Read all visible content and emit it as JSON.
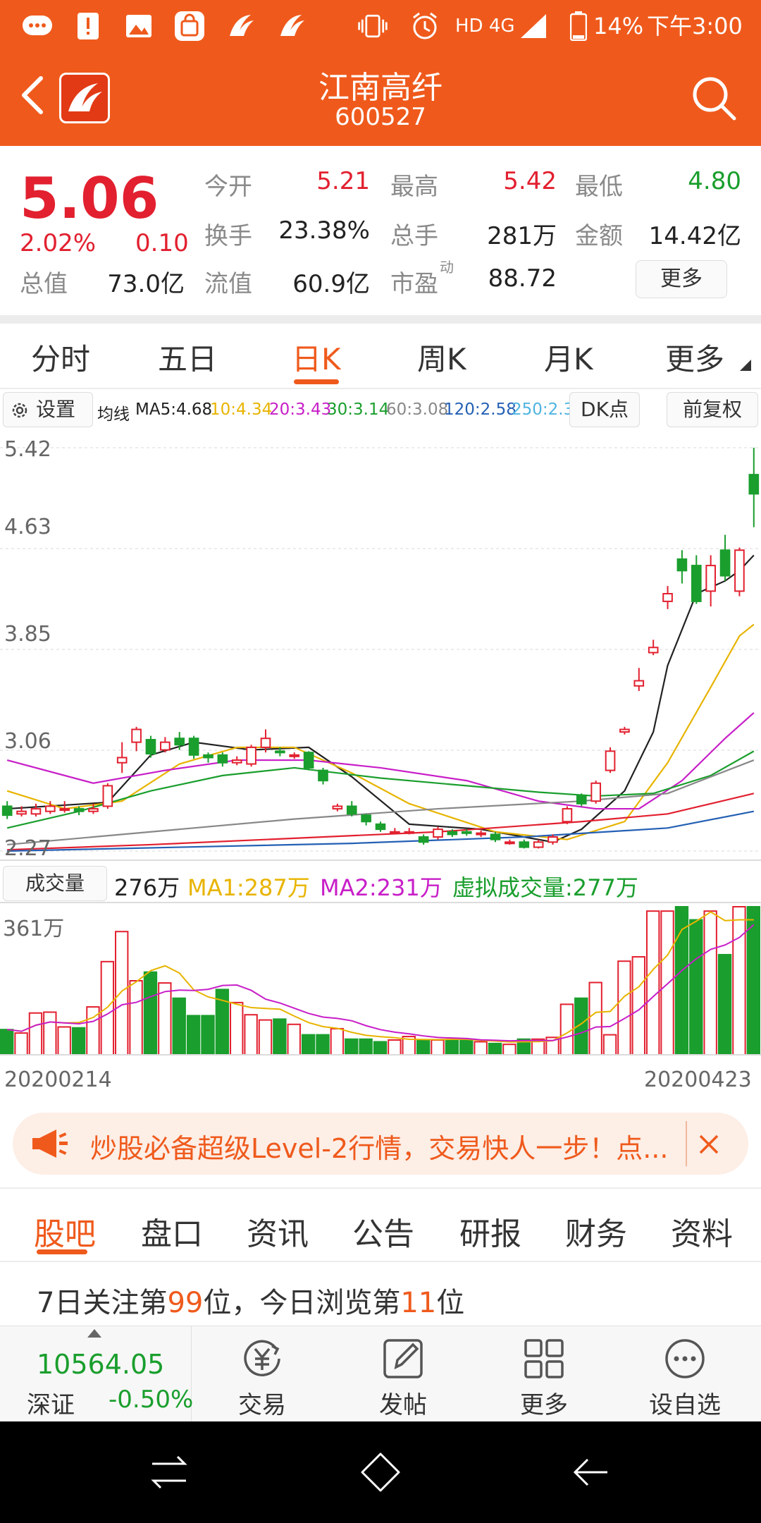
{
  "status_bar": {
    "network": "HD 4G",
    "battery": "14%",
    "time": "下午3:00"
  },
  "header": {
    "stock_name": "江南高纤",
    "stock_code": "600527"
  },
  "quote": {
    "price": "5.06",
    "change_pct": "2.02%",
    "change": "0.10",
    "fields": [
      {
        "label": "今开",
        "value": "5.21",
        "color": "#e2202f"
      },
      {
        "label": "最高",
        "value": "5.42",
        "color": "#e2202f"
      },
      {
        "label": "最低",
        "value": "4.80",
        "color": "#1a9e2d"
      },
      {
        "label": "换手",
        "value": "23.38%",
        "color": "#222222"
      },
      {
        "label": "总手",
        "value": "281万",
        "color": "#222222"
      },
      {
        "label": "金额",
        "value": "14.42亿",
        "color": "#222222"
      },
      {
        "label": "总值",
        "value": "73.0亿",
        "color": "#222222"
      },
      {
        "label": "流值",
        "value": "60.9亿",
        "color": "#222222"
      },
      {
        "label": "市盈",
        "value": "88.72",
        "color": "#222222"
      }
    ],
    "pe_superscript": "动",
    "more_label": "更多"
  },
  "period_tabs": [
    "分时",
    "五日",
    "日K",
    "周K",
    "月K",
    "更多"
  ],
  "period_active": "日K",
  "indicator_bar": {
    "settings_label": "设置",
    "ma_prefix": "均线",
    "ma": [
      {
        "text": "MA5:4.68",
        "color": "#222222"
      },
      {
        "text": "10:4.34",
        "color": "#e8b400"
      },
      {
        "text": "20:3.43",
        "color": "#c81ec8"
      },
      {
        "text": "30:3.14",
        "color": "#1a9e2d"
      },
      {
        "text": "60:3.08",
        "color": "#888888"
      },
      {
        "text": "120:2.58",
        "color": "#2460b4"
      },
      {
        "text": "250:2.3",
        "color": "#4fb4e0"
      }
    ],
    "dk_label": "DK点",
    "adjust_label": "前复权"
  },
  "price_axis": [
    "5.42",
    "4.63",
    "3.85",
    "3.06",
    "2.27"
  ],
  "chart_data": {
    "type": "candlestick",
    "ylim": [
      2.27,
      5.42
    ],
    "date_start": "20200214",
    "date_end": "20200423",
    "candles": [
      {
        "o": 2.62,
        "c": 2.55,
        "h": 2.66,
        "l": 2.52
      },
      {
        "o": 2.56,
        "c": 2.58,
        "h": 2.62,
        "l": 2.54
      },
      {
        "o": 2.56,
        "c": 2.6,
        "h": 2.64,
        "l": 2.54
      },
      {
        "o": 2.58,
        "c": 2.62,
        "h": 2.66,
        "l": 2.56
      },
      {
        "o": 2.6,
        "c": 2.6,
        "h": 2.66,
        "l": 2.57
      },
      {
        "o": 2.6,
        "c": 2.58,
        "h": 2.62,
        "l": 2.55
      },
      {
        "o": 2.58,
        "c": 2.6,
        "h": 2.64,
        "l": 2.56
      },
      {
        "o": 2.62,
        "c": 2.78,
        "h": 2.8,
        "l": 2.6
      },
      {
        "o": 2.96,
        "c": 3.0,
        "h": 3.12,
        "l": 2.88
      },
      {
        "o": 3.12,
        "c": 3.22,
        "h": 3.24,
        "l": 3.05
      },
      {
        "o": 3.14,
        "c": 3.03,
        "h": 3.17,
        "l": 3.0
      },
      {
        "o": 3.06,
        "c": 3.12,
        "h": 3.16,
        "l": 3.04
      },
      {
        "o": 3.15,
        "c": 3.1,
        "h": 3.2,
        "l": 3.06
      },
      {
        "o": 3.15,
        "c": 3.02,
        "h": 3.17,
        "l": 2.99
      },
      {
        "o": 3.02,
        "c": 3.0,
        "h": 3.04,
        "l": 2.96
      },
      {
        "o": 3.02,
        "c": 2.96,
        "h": 3.04,
        "l": 2.93
      },
      {
        "o": 2.96,
        "c": 2.98,
        "h": 3.01,
        "l": 2.94
      },
      {
        "o": 2.95,
        "c": 3.08,
        "h": 3.1,
        "l": 2.93
      },
      {
        "o": 3.08,
        "c": 3.15,
        "h": 3.22,
        "l": 3.04
      },
      {
        "o": 3.05,
        "c": 3.04,
        "h": 3.08,
        "l": 3.01
      },
      {
        "o": 3.02,
        "c": 3.02,
        "h": 3.04,
        "l": 2.99
      },
      {
        "o": 3.04,
        "c": 2.92,
        "h": 3.05,
        "l": 2.9
      },
      {
        "o": 2.9,
        "c": 2.82,
        "h": 2.92,
        "l": 2.79
      },
      {
        "o": 2.6,
        "c": 2.62,
        "h": 2.64,
        "l": 2.58
      },
      {
        "o": 2.62,
        "c": 2.56,
        "h": 2.66,
        "l": 2.54
      },
      {
        "o": 2.55,
        "c": 2.5,
        "h": 2.56,
        "l": 2.47
      },
      {
        "o": 2.48,
        "c": 2.44,
        "h": 2.5,
        "l": 2.42
      },
      {
        "o": 2.42,
        "c": 2.42,
        "h": 2.45,
        "l": 2.4
      },
      {
        "o": 2.42,
        "c": 2.42,
        "h": 2.45,
        "l": 2.4
      },
      {
        "o": 2.38,
        "c": 2.34,
        "h": 2.4,
        "l": 2.32
      },
      {
        "o": 2.38,
        "c": 2.44,
        "h": 2.46,
        "l": 2.36
      },
      {
        "o": 2.42,
        "c": 2.4,
        "h": 2.44,
        "l": 2.38
      },
      {
        "o": 2.42,
        "c": 2.41,
        "h": 2.44,
        "l": 2.39
      },
      {
        "o": 2.4,
        "c": 2.41,
        "h": 2.43,
        "l": 2.38
      },
      {
        "o": 2.4,
        "c": 2.36,
        "h": 2.42,
        "l": 2.34
      },
      {
        "o": 2.34,
        "c": 2.34,
        "h": 2.36,
        "l": 2.32
      },
      {
        "o": 2.34,
        "c": 2.3,
        "h": 2.36,
        "l": 2.29
      },
      {
        "o": 2.3,
        "c": 2.34,
        "h": 2.36,
        "l": 2.29
      },
      {
        "o": 2.34,
        "c": 2.38,
        "h": 2.4,
        "l": 2.32
      },
      {
        "o": 2.5,
        "c": 2.6,
        "h": 2.62,
        "l": 2.48
      },
      {
        "o": 2.7,
        "c": 2.64,
        "h": 2.72,
        "l": 2.62
      },
      {
        "o": 2.66,
        "c": 2.8,
        "h": 2.82,
        "l": 2.64
      },
      {
        "o": 2.9,
        "c": 3.05,
        "h": 3.08,
        "l": 2.88
      },
      {
        "o": 3.2,
        "c": 3.22,
        "h": 3.24,
        "l": 3.18
      },
      {
        "o": 3.56,
        "c": 3.6,
        "h": 3.7,
        "l": 3.52
      },
      {
        "o": 3.82,
        "c": 3.86,
        "h": 3.92,
        "l": 3.8
      },
      {
        "o": 4.22,
        "c": 4.28,
        "h": 4.34,
        "l": 4.16
      },
      {
        "o": 4.55,
        "c": 4.46,
        "h": 4.62,
        "l": 4.36
      },
      {
        "o": 4.5,
        "c": 4.22,
        "h": 4.58,
        "l": 4.2
      },
      {
        "o": 4.3,
        "c": 4.5,
        "h": 4.58,
        "l": 4.18
      },
      {
        "o": 4.62,
        "c": 4.42,
        "h": 4.74,
        "l": 4.38
      },
      {
        "o": 4.3,
        "c": 4.62,
        "h": 4.64,
        "l": 4.26
      },
      {
        "o": 5.21,
        "c": 5.06,
        "h": 5.42,
        "l": 4.8
      }
    ],
    "ma_lines": [
      {
        "name": "MA5",
        "color": "#222222",
        "points": [
          [
            0,
            2.6
          ],
          [
            7,
            2.65
          ],
          [
            10,
            3.02
          ],
          [
            13,
            3.12
          ],
          [
            17,
            3.06
          ],
          [
            21,
            3.08
          ],
          [
            24,
            2.85
          ],
          [
            28,
            2.48
          ],
          [
            33,
            2.44
          ],
          [
            38,
            2.34
          ],
          [
            40,
            2.44
          ],
          [
            43,
            2.74
          ],
          [
            45,
            3.2
          ],
          [
            46,
            3.72
          ],
          [
            48,
            4.28
          ],
          [
            50,
            4.38
          ],
          [
            51,
            4.46
          ],
          [
            52,
            4.58
          ]
        ]
      },
      {
        "name": "MA10",
        "color": "#e8b400",
        "points": [
          [
            0,
            2.74
          ],
          [
            4,
            2.6
          ],
          [
            8,
            2.66
          ],
          [
            12,
            2.95
          ],
          [
            16,
            3.08
          ],
          [
            20,
            3.08
          ],
          [
            24,
            2.88
          ],
          [
            28,
            2.64
          ],
          [
            34,
            2.42
          ],
          [
            39,
            2.36
          ],
          [
            43,
            2.5
          ],
          [
            46,
            2.96
          ],
          [
            49,
            3.55
          ],
          [
            51,
            3.95
          ],
          [
            52,
            4.04
          ]
        ]
      },
      {
        "name": "MA20",
        "color": "#c81ec8",
        "points": [
          [
            0,
            2.98
          ],
          [
            6,
            2.8
          ],
          [
            11,
            2.9
          ],
          [
            16,
            2.98
          ],
          [
            21,
            2.98
          ],
          [
            26,
            2.92
          ],
          [
            32,
            2.82
          ],
          [
            37,
            2.66
          ],
          [
            41,
            2.6
          ],
          [
            44,
            2.6
          ],
          [
            47,
            2.82
          ],
          [
            50,
            3.15
          ],
          [
            52,
            3.35
          ]
        ]
      },
      {
        "name": "MA30",
        "color": "#1a9e2d",
        "points": [
          [
            0,
            2.45
          ],
          [
            5,
            2.58
          ],
          [
            10,
            2.74
          ],
          [
            15,
            2.86
          ],
          [
            20,
            2.92
          ],
          [
            26,
            2.84
          ],
          [
            32,
            2.78
          ],
          [
            37,
            2.73
          ],
          [
            41,
            2.7
          ],
          [
            45,
            2.72
          ],
          [
            49,
            2.86
          ],
          [
            52,
            3.05
          ]
        ]
      },
      {
        "name": "MA60",
        "color": "#888888",
        "points": [
          [
            0,
            2.32
          ],
          [
            10,
            2.42
          ],
          [
            20,
            2.52
          ],
          [
            30,
            2.6
          ],
          [
            40,
            2.66
          ],
          [
            46,
            2.72
          ],
          [
            52,
            2.98
          ]
        ]
      },
      {
        "name": "MA120",
        "color": "#e2202f",
        "points": [
          [
            0,
            2.28
          ],
          [
            10,
            2.32
          ],
          [
            20,
            2.37
          ],
          [
            30,
            2.42
          ],
          [
            40,
            2.5
          ],
          [
            46,
            2.56
          ],
          [
            52,
            2.72
          ]
        ]
      },
      {
        "name": "MA250",
        "color": "#2460b4",
        "points": [
          [
            0,
            2.27
          ],
          [
            12,
            2.3
          ],
          [
            24,
            2.33
          ],
          [
            36,
            2.38
          ],
          [
            46,
            2.45
          ],
          [
            52,
            2.58
          ]
        ]
      }
    ],
    "volume": {
      "max_label": "361万",
      "values": [
        58,
        50,
        96,
        98,
        64,
        62,
        110,
        214,
        283,
        170,
        190,
        165,
        130,
        90,
        90,
        150,
        120,
        92,
        80,
        82,
        70,
        46,
        46,
        60,
        36,
        36,
        30,
        34,
        42,
        34,
        34,
        34,
        34,
        30,
        26,
        24,
        36,
        36,
        40,
        116,
        130,
        166,
        46,
        215,
        225,
        330,
        330,
        340,
        310,
        330,
        230,
        340,
        340
      ]
    }
  },
  "volume_bar": {
    "label": "成交量",
    "current": "276万",
    "ma1": "MA1:287万",
    "ma2": "MA2:231万",
    "virtual": "虚拟成交量:277万"
  },
  "banner": {
    "text": "炒股必备超级Level-2行情，交易快人一步！点..."
  },
  "sub_tabs": [
    "股吧",
    "盘口",
    "资讯",
    "公告",
    "研报",
    "财务",
    "资料"
  ],
  "sub_tab_active": "股吧",
  "rank": {
    "prefix": "7日关注第",
    "rank_7d": "99",
    "middle": "位，今日浏览第",
    "rank_today": "11",
    "suffix": "位"
  },
  "toolbar": {
    "index_value": "10564.05",
    "index_name": "深证",
    "index_change": "-0.50%",
    "items": [
      "交易",
      "发帖",
      "更多",
      "设自选"
    ]
  },
  "colors": {
    "brand": "#ef5a1c",
    "up": "#e2202f",
    "down": "#1a9e2d"
  }
}
